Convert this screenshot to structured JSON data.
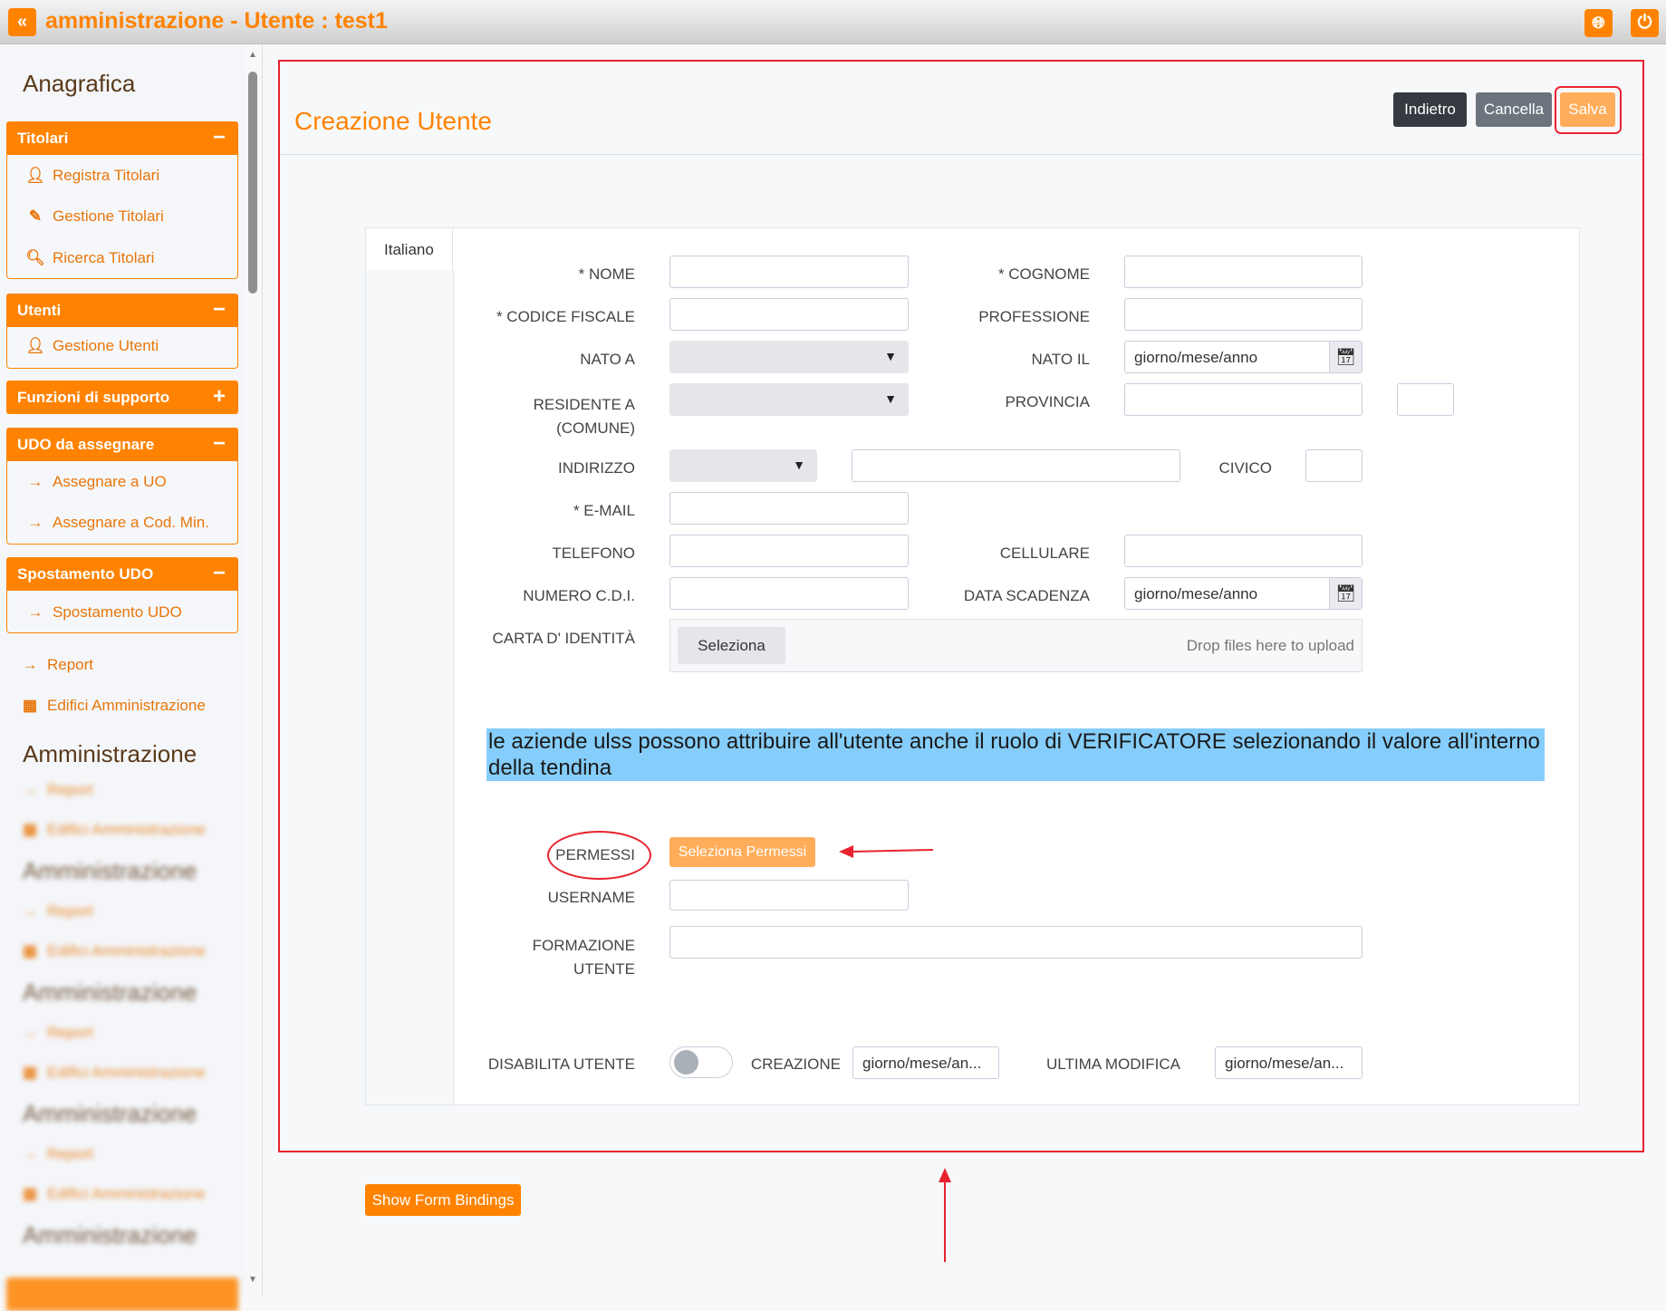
{
  "header": {
    "title": "amministrazione - Utente : test1",
    "back_icon": "double-chevron-left-icon",
    "globe_icon": "globe-icon",
    "power_icon": "power-icon",
    "accent": "#ff8300"
  },
  "sidebar": {
    "group1": "Anagrafica",
    "sections": [
      {
        "title": "Titolari",
        "toggle": "−",
        "items": [
          "Registra Titolari",
          "Gestione Titolari",
          "Ricerca Titolari"
        ]
      },
      {
        "title": "Utenti",
        "toggle": "−",
        "items": [
          "Gestione Utenti"
        ]
      },
      {
        "title": "Funzioni di supporto",
        "toggle": "+",
        "items": []
      },
      {
        "title": "UDO da assegnare",
        "toggle": "−",
        "items": [
          "Assegnare a UO",
          "Assegnare a Cod. Min."
        ]
      },
      {
        "title": "Spostamento UDO",
        "toggle": "−",
        "items": [
          "Spostamento UDO"
        ]
      }
    ],
    "links": [
      "Report",
      "Edifici Amministrazione"
    ],
    "group2": "Amministrazione"
  },
  "page": {
    "title": "Creazione Utente",
    "buttons": {
      "back": "Indietro",
      "cancel": "Cancella",
      "save": "Salva"
    }
  },
  "form": {
    "tab": "Italiano",
    "labels": {
      "nome": "* NOME",
      "cognome": "* COGNOME",
      "codice_fiscale": "* CODICE FISCALE",
      "professione": "PROFESSIONE",
      "nato_a": "NATO A",
      "nato_il": "NATO IL",
      "residente_a": "RESIDENTE A",
      "comune": "(COMUNE)",
      "provincia": "PROVINCIA",
      "indirizzo": "INDIRIZZO",
      "civico": "CIVICO",
      "email": "* E-MAIL",
      "telefono": "TELEFONO",
      "cellulare": "CELLULARE",
      "numero_cdi": "NUMERO C.D.I.",
      "data_scadenza": "DATA SCADENZA",
      "carta": "CARTA D' IDENTITÀ",
      "permessi": "PERMESSI",
      "username": "USERNAME",
      "formazione": "FORMAZIONE",
      "utente": "UTENTE",
      "disabilita": "DISABILITA UTENTE",
      "creazione": "CREAZIONE",
      "ultima_modifica": "ULTIMA MODIFICA"
    },
    "date_placeholder": "giorno/mese/anno",
    "creazione_value": "giorno/mese/an...",
    "ultima_modifica_value": "giorno/mese/an...",
    "upload": {
      "button": "Seleziona",
      "drop": "Drop files here to upload"
    },
    "permessi_button": "Seleziona Permessi",
    "disabilita_toggle": false
  },
  "annotation": {
    "note": "le aziende ulss possono attribuire all'utente anche il ruolo di VERIFICATORE selezionando il valore all'interno della tendina",
    "highlight_color": "#85cdfa",
    "mark_color": "#e8232f"
  },
  "footer": {
    "show_bindings": "Show Form Bindings"
  }
}
